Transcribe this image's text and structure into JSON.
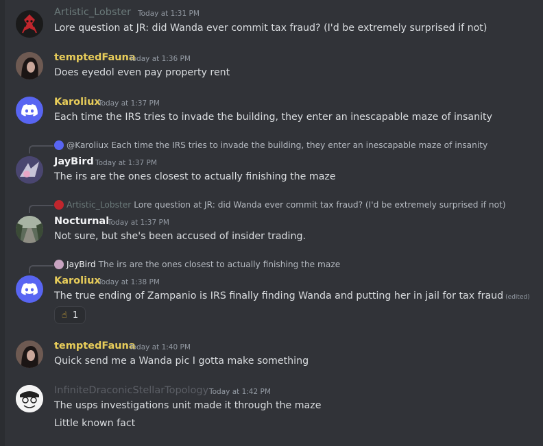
{
  "colors": {
    "background": "#313338",
    "name_yellow": "#e8cd5a",
    "name_gray": "#6b7a7a",
    "name_dim": "#5c5f66",
    "name_white": "#f2f3f5",
    "discord_blurple": "#5865f2"
  },
  "messages": [
    {
      "author": "Artistic_Lobster",
      "time": "Today at 1:31 PM",
      "text": "Lore question at JR: did Wanda ever commit tax fraud? (I'd be extremely surprised if not)"
    },
    {
      "author": "temptedFauna",
      "time": "Today at 1:36 PM",
      "text": "Does eyedol even pay property rent"
    },
    {
      "author": "Karoliux",
      "time": "Today at 1:37 PM",
      "text": "Each time the IRS tries to invade the building, they enter an inescapable maze of insanity"
    },
    {
      "reply_author": "@Karoliux",
      "reply_text": "Each time the IRS tries to invade the building, they enter an inescapable maze of insanity",
      "author": "JayBird",
      "time": "Today at 1:37 PM",
      "text": "The irs are the ones closest to actually finishing the maze"
    },
    {
      "reply_author": "Artistic_Lobster",
      "reply_text": "Lore question at JR: did Wanda ever commit tax fraud? (I'd be extremely surprised if not)",
      "author": "Nocturnal",
      "time": "Today at 1:37 PM",
      "text": "Not sure, but she's been accused of insider trading."
    },
    {
      "reply_author": "JayBird",
      "reply_text": "The irs are the ones closest to actually finishing the maze",
      "author": "Karoliux",
      "time": "Today at 1:38 PM",
      "text": "The true ending of Zampanio is IRS finally finding Wanda and putting her in jail for tax fraud",
      "edited": "(edited)",
      "reaction_emoji": "☝",
      "reaction_count": "1"
    },
    {
      "author": "temptedFauna",
      "time": "Today at 1:40 PM",
      "text": "Quick send me a Wanda pic I gotta make something"
    },
    {
      "author": "InfiniteDraconicStellarTopology",
      "time": "Today at 1:42 PM",
      "text": "The usps investigations unit made it through the maze",
      "text2": "Little known fact"
    }
  ]
}
